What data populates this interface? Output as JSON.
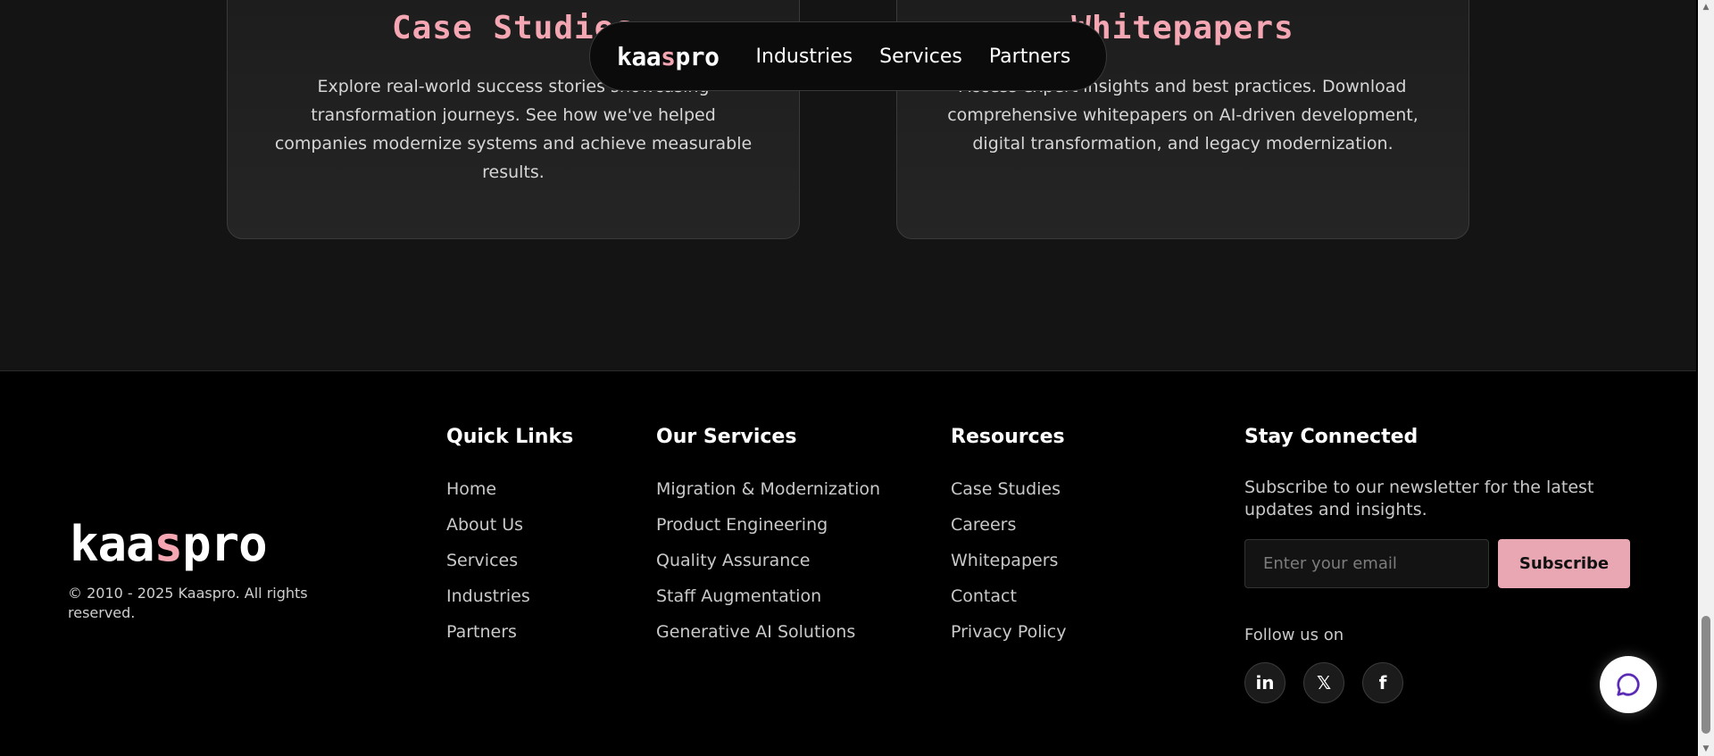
{
  "nav": {
    "logo": {
      "part1": "kaa",
      "accent": "s",
      "part2": "pro"
    },
    "links": [
      "Industries",
      "Services",
      "Partners"
    ]
  },
  "cards": [
    {
      "title": "Case Studies",
      "description": "Explore real-world success stories showcasing transformation journeys. See how we've helped companies modernize systems and achieve measurable results."
    },
    {
      "title": "Whitepapers",
      "description": "Access expert insights and best practices. Download comprehensive whitepapers on AI-driven development, digital transformation, and legacy modernization."
    }
  ],
  "footer": {
    "logo": {
      "part1": "kaa",
      "accent": "s",
      "part2": "pro"
    },
    "copyright": "© 2010 - 2025 Kaaspro. All rights reserved.",
    "quick_links": {
      "heading": "Quick Links",
      "items": [
        "Home",
        "About Us",
        "Services",
        "Industries",
        "Partners"
      ]
    },
    "services": {
      "heading": "Our Services",
      "items": [
        "Migration & Modernization",
        "Product Engineering",
        "Quality Assurance",
        "Staff Augmentation",
        "Generative AI Solutions"
      ]
    },
    "resources": {
      "heading": "Resources",
      "items": [
        "Case Studies",
        "Careers",
        "Whitepapers",
        "Contact",
        "Privacy Policy"
      ]
    },
    "connect": {
      "heading": "Stay Connected",
      "text": "Subscribe to our newsletter for the latest updates and insights.",
      "email_placeholder": "Enter your email",
      "subscribe_label": "Subscribe",
      "follow_label": "Follow us on",
      "socials": [
        {
          "icon": "linkedin-icon",
          "glyph": "in"
        },
        {
          "icon": "x-icon",
          "glyph": "𝕏"
        },
        {
          "icon": "facebook-icon",
          "glyph": "f"
        }
      ]
    }
  },
  "colors": {
    "accent": "#f4a7b3",
    "button": "#e8a7b2",
    "background": "#000000",
    "section_background": "#141414",
    "chat_icon": "#5b2bb5"
  }
}
